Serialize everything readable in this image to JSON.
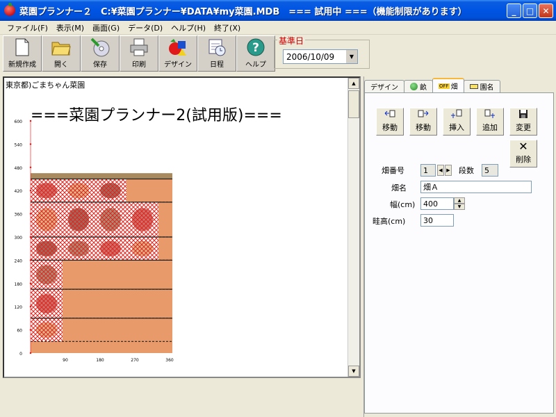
{
  "window": {
    "title": "菜園プランナー２　C:¥菜園プランナー¥DATA¥my菜園.MDB　=== 試用中 ===（機能制限があります）",
    "minimize": "_",
    "maximize": "□",
    "close": "✕"
  },
  "menu": [
    {
      "label": "ファイル(F)"
    },
    {
      "label": "表示(M)"
    },
    {
      "label": "画面(G)"
    },
    {
      "label": "データ(D)"
    },
    {
      "label": "ヘルプ(H)"
    },
    {
      "label": "終了(X)"
    }
  ],
  "toolbar": [
    {
      "label": "新規作成",
      "icon": "new-document-icon"
    },
    {
      "label": "開く",
      "icon": "open-folder-icon"
    },
    {
      "label": "保存",
      "icon": "save-disk-icon"
    },
    {
      "label": "印刷",
      "icon": "printer-icon"
    },
    {
      "label": "デザイン",
      "icon": "design-shapes-icon"
    },
    {
      "label": "日程",
      "icon": "schedule-calendar-icon"
    },
    {
      "label": "ヘルプ",
      "icon": "help-icon"
    }
  ],
  "kijun": {
    "label": "基準日",
    "value": "2006/10/09"
  },
  "canvas": {
    "garden_name": "東京都)ごまちゃん菜園",
    "title": "===菜園プランナー2(試用版)==="
  },
  "chart_data": {
    "type": "heatmap",
    "y_ticks": [
      0,
      60,
      120,
      180,
      240,
      300,
      360,
      420,
      480,
      540,
      600
    ],
    "x_ticks": [
      90,
      180,
      270,
      360
    ],
    "xlim": [
      0,
      360
    ],
    "ylim": [
      0,
      600
    ],
    "bed_width_cm": 360,
    "bed_top_cm": 465,
    "rows": [
      {
        "y_top": 450,
        "y_bottom": 390,
        "crops": 3
      },
      {
        "y_top": 390,
        "y_bottom": 300,
        "crops": 4
      },
      {
        "y_top": 300,
        "y_bottom": 240,
        "crops": 4
      },
      {
        "y_top": 240,
        "y_bottom": 165,
        "crops": 1
      },
      {
        "y_top": 165,
        "y_bottom": 90,
        "crops": 1
      },
      {
        "y_top": 90,
        "y_bottom": 30,
        "crops": 1
      }
    ]
  },
  "tabs": [
    {
      "label": "デザイン",
      "icon": ""
    },
    {
      "label": "畝",
      "icon": "ridge-icon"
    },
    {
      "label": "畑",
      "icon": "field-off-icon",
      "badge": "OFF"
    },
    {
      "label": "園名",
      "icon": "garden-name-icon"
    }
  ],
  "actions": [
    {
      "label": "移動",
      "icon": "move-left-icon"
    },
    {
      "label": "移動",
      "icon": "move-right-icon"
    },
    {
      "label": "挿入",
      "icon": "insert-icon"
    },
    {
      "label": "追加",
      "icon": "add-icon"
    },
    {
      "label": "変更",
      "icon": "save-icon"
    },
    {
      "label": "削除",
      "icon": "delete-x-icon"
    }
  ],
  "fields": {
    "field_no_label": "畑番号",
    "field_no_value": "1",
    "dansu_label": "段数",
    "dansu_value": "5",
    "name_label": "畑名",
    "name_value": "畑Ａ",
    "width_label": "幅(cm)",
    "width_value": "400",
    "height_label": "畦高(cm)",
    "height_value": "30"
  },
  "colors": {
    "title_bar": "#0054E3",
    "bed_fill": "#E99A6A",
    "bed_top": "#A98A5E",
    "hatch": "#E3231D",
    "row_line": "#222222"
  }
}
